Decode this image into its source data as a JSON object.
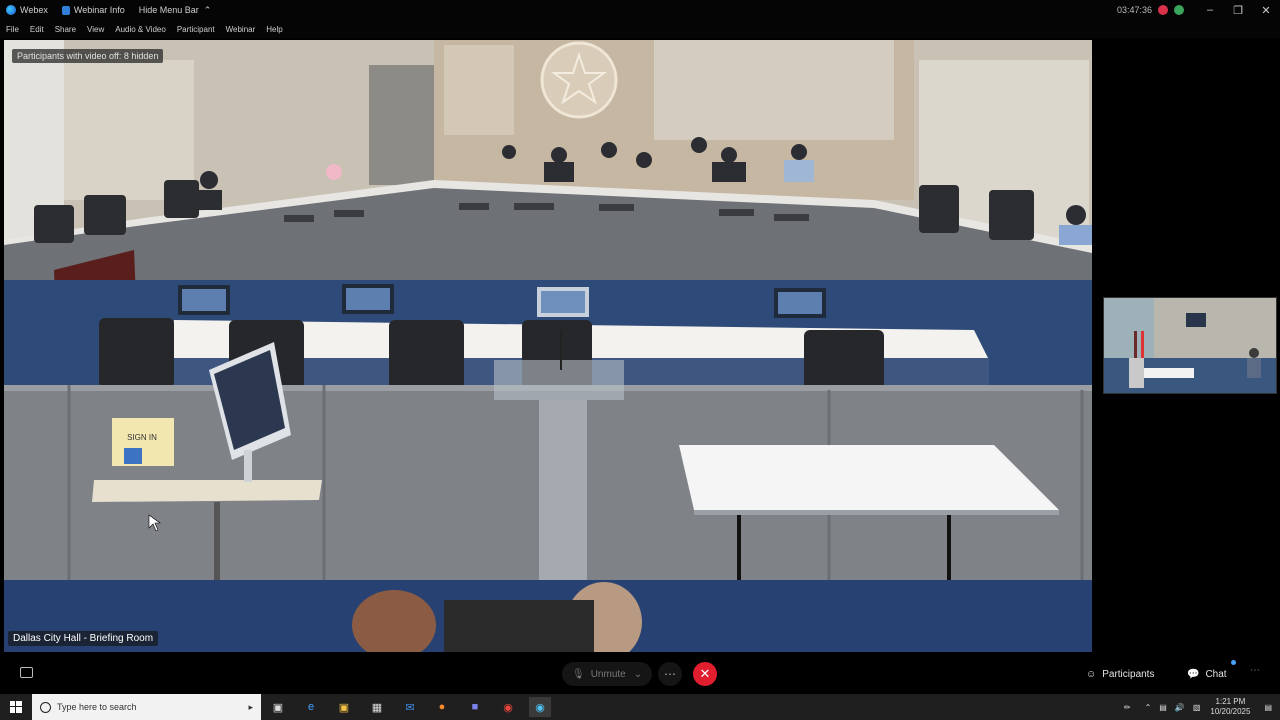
{
  "titlebar": {
    "app_name": "Webex",
    "webinar_info": "Webinar Info",
    "hide_menu": "Hide Menu Bar",
    "time": "03:47:36"
  },
  "menu": [
    "File",
    "Edit",
    "Share",
    "View",
    "Audio & Video",
    "Participant",
    "Webinar",
    "Help"
  ],
  "video": {
    "top_label": "Participants with video off: 8 hidden",
    "bottom_label": "Dallas City Hall - Briefing Room",
    "sign_text": "SIGN IN"
  },
  "controls": {
    "unmute": "Unmute",
    "participants": "Participants",
    "chat": "Chat"
  },
  "taskbar": {
    "search_placeholder": "Type here to search",
    "time": "1:21 PM",
    "date": "10/20/2025"
  },
  "colors": {
    "end_call": "#e01e2e",
    "record": "#d9324a",
    "carpet": "#2d4a78"
  }
}
